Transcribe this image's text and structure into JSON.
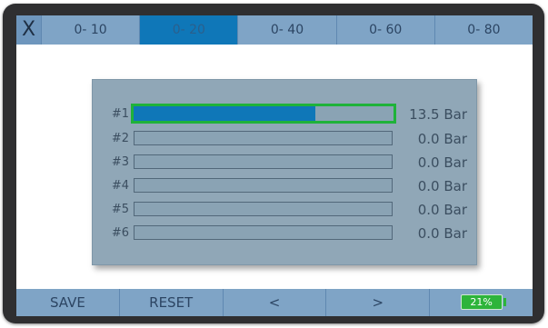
{
  "topbar": {
    "close_label": "X",
    "ranges": [
      "0- 10",
      "0- 20",
      "0- 40",
      "0- 60",
      "0- 80"
    ],
    "active_range": "0- 20"
  },
  "channels": [
    {
      "label": "#1",
      "value": "13.5 Bar",
      "fill": 0.7,
      "selected": true
    },
    {
      "label": "#2",
      "value": "0.0 Bar",
      "fill": 0,
      "selected": false
    },
    {
      "label": "#3",
      "value": "0.0 Bar",
      "fill": 0,
      "selected": false
    },
    {
      "label": "#4",
      "value": "0.0 Bar",
      "fill": 0,
      "selected": false
    },
    {
      "label": "#5",
      "value": "0.0 Bar",
      "fill": 0,
      "selected": false
    },
    {
      "label": "#6",
      "value": "0.0 Bar",
      "fill": 0,
      "selected": false
    }
  ],
  "bottombar": {
    "save_label": "SAVE",
    "reset_label": "RESET",
    "prev_label": "<",
    "next_label": ">",
    "battery_label": "21%"
  },
  "colors": {
    "accent": "#0f77b8",
    "bar_fill": "#0f77b8",
    "selected_border": "#1fb23a",
    "battery": "#2db43a",
    "toolbar": "#7fa4c6"
  },
  "icons": {
    "close": "close-icon",
    "prev": "chevron-left-icon",
    "next": "chevron-right-icon",
    "battery": "battery-icon"
  }
}
